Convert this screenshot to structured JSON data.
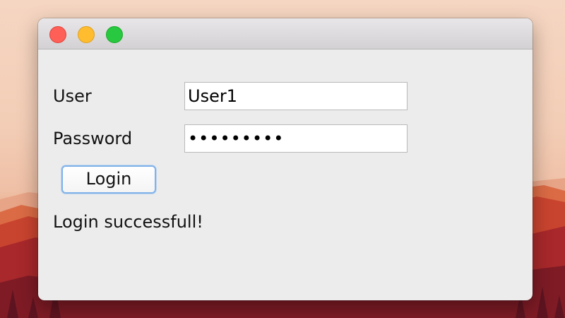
{
  "window": {
    "title": ""
  },
  "form": {
    "user_label": "User",
    "user_value": "User1",
    "password_label": "Password",
    "password_value": "•••••••••",
    "login_label": "Login"
  },
  "status": {
    "message": "Login successfull!"
  },
  "colors": {
    "close": "#fe5f57",
    "minimize": "#febc2e",
    "zoom": "#28c840",
    "button_focus": "#7fb2ea"
  }
}
